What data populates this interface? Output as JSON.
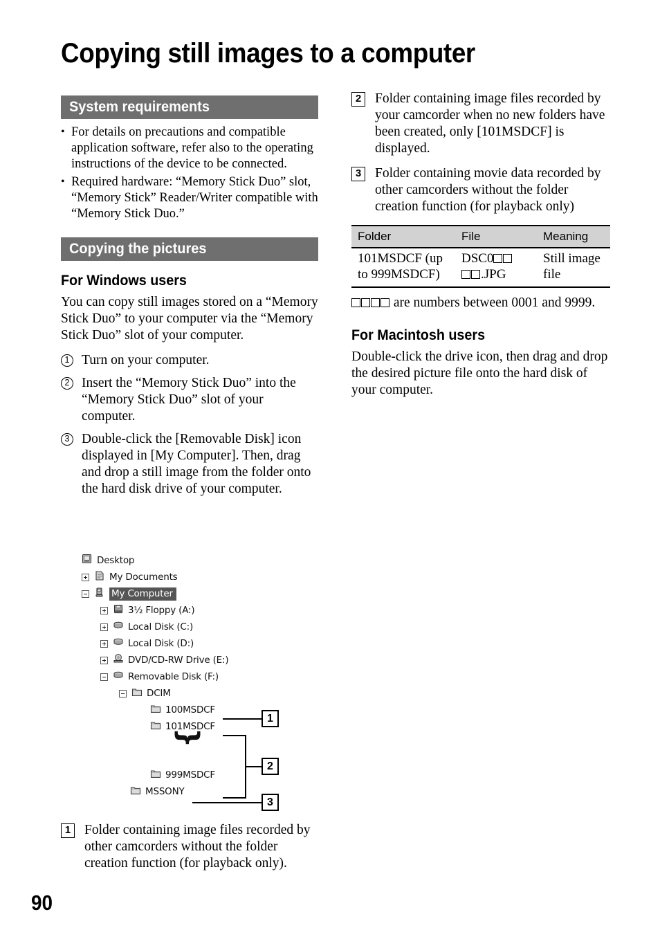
{
  "page": {
    "title": "Copying still images to a computer",
    "number": "90"
  },
  "left_column": {
    "section_system_requirements": {
      "heading": "System requirements",
      "bullets": [
        "For details on precautions and compatible application software, refer also to the operating instructions of the device to be connected.",
        "Required hardware: “Memory Stick Duo” slot, “Memory Stick” Reader/Writer compatible with “Memory Stick Duo.”"
      ]
    },
    "section_copying_the_pictures": {
      "heading": "Copying the pictures",
      "subheading_windows": "For Windows users",
      "intro": "You can copy still images stored on a “Memory Stick Duo” to your computer via the “Memory Stick Duo” slot of your computer.",
      "steps": [
        {
          "marker": "1",
          "text": "Turn on your computer."
        },
        {
          "marker": "2",
          "text": "Insert the “Memory Stick Duo” into the “Memory Stick Duo” slot of your computer."
        },
        {
          "marker": "3",
          "text": "Double-click the [Removable Disk] icon displayed in [My Computer]. Then, drag and drop a still image from the folder onto the hard disk drive of your computer."
        }
      ]
    },
    "note_1": {
      "marker": "1",
      "text": "Folder containing image files recorded by other camcorders without the folder creation function (for playback only)."
    }
  },
  "tree_diagram": {
    "rows": [
      {
        "label": "Desktop",
        "icon": "desktop-icon",
        "expander": "none",
        "indent": 0,
        "selected": false
      },
      {
        "label": "My Documents",
        "icon": "documents-folder-icon",
        "expander": "plus",
        "indent": 1,
        "selected": false
      },
      {
        "label": "My Computer",
        "icon": "my-computer-icon",
        "expander": "minus",
        "indent": 1,
        "selected": true
      },
      {
        "label": "3½ Floppy (A:)",
        "icon": "floppy-drive-icon",
        "expander": "plus",
        "indent": 2,
        "selected": false
      },
      {
        "label": "Local Disk (C:)",
        "icon": "hard-disk-icon",
        "expander": "plus",
        "indent": 2,
        "selected": false
      },
      {
        "label": "Local Disk (D:)",
        "icon": "hard-disk-icon",
        "expander": "plus",
        "indent": 2,
        "selected": false
      },
      {
        "label": "DVD/CD-RW Drive (E:)",
        "icon": "optical-drive-icon",
        "expander": "plus",
        "indent": 2,
        "selected": false
      },
      {
        "label": "Removable Disk (F:)",
        "icon": "removable-disk-icon",
        "expander": "minus",
        "indent": 2,
        "selected": false
      },
      {
        "label": "DCIM",
        "icon": "folder-icon",
        "expander": "minus",
        "indent": 3,
        "selected": false
      },
      {
        "label": "100MSDCF",
        "icon": "folder-icon",
        "expander": "none",
        "indent": 4,
        "selected": false
      },
      {
        "label": "101MSDCF",
        "icon": "folder-icon",
        "expander": "none",
        "indent": 4,
        "selected": false
      },
      {
        "label": "999MSDCF",
        "icon": "folder-icon",
        "expander": "none",
        "indent": 4,
        "selected": false
      },
      {
        "label": "MSSONY",
        "icon": "folder-icon",
        "expander": "none",
        "indent": 3,
        "selected": false
      }
    ],
    "ellipsis_glyph": "}",
    "callouts": [
      {
        "marker": "1",
        "target": "100MSDCF"
      },
      {
        "marker": "2",
        "target": "101MSDCF–999MSDCF"
      },
      {
        "marker": "3",
        "target": "MSSONY"
      }
    ]
  },
  "right_column": {
    "notes": [
      {
        "marker": "2",
        "text": "Folder containing image files recorded by your camcorder when no new folders have been created, only [101MSDCF] is displayed."
      },
      {
        "marker": "3",
        "text": "Folder containing movie data recorded by other camcorders without the folder creation function (for playback only)"
      }
    ],
    "table": {
      "headers": [
        "Folder",
        "File",
        "Meaning"
      ],
      "rows": [
        {
          "folder": "101MSDCF (up to 999MSDCF)",
          "file_prefix": "DSC0",
          "file_suffix": ".JPG",
          "meaning": "Still image file"
        }
      ]
    },
    "table_footnote_prefix": "",
    "table_footnote_text": " are numbers between 0001 and 9999.",
    "subheading_macintosh": "For Macintosh users",
    "macintosh_text": "Double-click the drive icon, then drag and drop the desired picture file onto the hard disk of your computer."
  },
  "colors": {
    "section_bar_bg": "#6f6f6f",
    "section_bar_text": "#ffffff",
    "table_header_bg": "#d2d2d2",
    "tree_selection_bg": "#555555",
    "page_bg": "#ffffff",
    "text": "#000000"
  }
}
